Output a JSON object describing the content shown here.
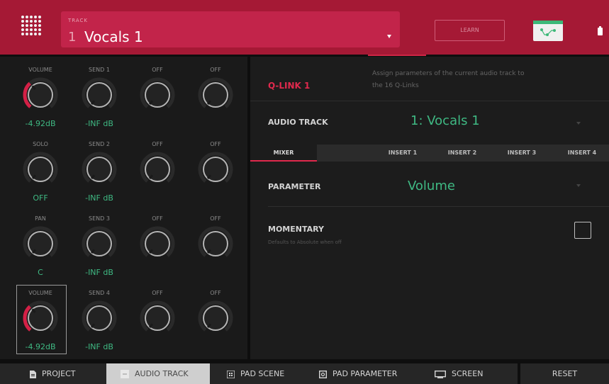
{
  "header": {
    "track_caption": "TRACK",
    "track_number": "1",
    "track_name": "Vocals 1",
    "learn_label": "LEARN",
    "colors": {
      "header_bg": "#a51935",
      "track_box": "#c2244a",
      "automation_green": "#3cb878"
    },
    "icons": [
      "grid-menu-icon",
      "chevron-down-icon",
      "automation-icon",
      "battery-icon"
    ]
  },
  "knobs": {
    "rows": [
      [
        {
          "label": "VOLUME",
          "value": "-4.92dB",
          "level": 0.35
        },
        {
          "label": "SEND 1",
          "value": "-INF dB",
          "level": 0
        },
        {
          "label": "OFF",
          "value": "",
          "level": 0
        },
        {
          "label": "OFF",
          "value": "",
          "level": 0
        }
      ],
      [
        {
          "label": "SOLO",
          "value": "OFF",
          "level": 0
        },
        {
          "label": "SEND 2",
          "value": "-INF dB",
          "level": 0
        },
        {
          "label": "OFF",
          "value": "",
          "level": 0
        },
        {
          "label": "OFF",
          "value": "",
          "level": 0
        }
      ],
      [
        {
          "label": "PAN",
          "value": "C",
          "level": 0
        },
        {
          "label": "SEND 3",
          "value": "-INF dB",
          "level": 0
        },
        {
          "label": "OFF",
          "value": "",
          "level": 0
        },
        {
          "label": "OFF",
          "value": "",
          "level": 0
        }
      ],
      [
        {
          "label": "VOLUME",
          "value": "-4.92dB",
          "level": 0.35
        },
        {
          "label": "SEND 4",
          "value": "-INF dB",
          "level": 0
        },
        {
          "label": "OFF",
          "value": "",
          "level": 0
        },
        {
          "label": "OFF",
          "value": "",
          "level": 0
        }
      ]
    ],
    "selected_knob": "row 4, knob 1"
  },
  "qlink": {
    "title": "Q-LINK 1",
    "description": "Assign parameters of the current audio track to the 16 Q-Links",
    "audio_track_label": "AUDIO TRACK",
    "audio_track_value": "1: Vocals 1",
    "tabs": [
      "MIXER",
      "INSERT 1",
      "INSERT 2",
      "INSERT 3",
      "INSERT 4"
    ],
    "active_tab": "MIXER",
    "parameter_label": "PARAMETER",
    "parameter_value": "Volume",
    "momentary_label": "MOMENTARY",
    "momentary_desc": "Defaults to Absolute when off",
    "momentary_checked": false,
    "colors": {
      "accent": "#e0294d",
      "value_green": "#3fb983"
    }
  },
  "bottom_nav": {
    "items": [
      {
        "label": "PROJECT",
        "icon": "document-icon"
      },
      {
        "label": "AUDIO TRACK",
        "icon": "audio-track-icon"
      },
      {
        "label": "PAD SCENE",
        "icon": "pad-grid-icon"
      },
      {
        "label": "PAD PARAMETER",
        "icon": "pad-parameter-icon"
      },
      {
        "label": "SCREEN",
        "icon": "screen-icon"
      }
    ],
    "active": "AUDIO TRACK",
    "reset_label": "RESET"
  }
}
